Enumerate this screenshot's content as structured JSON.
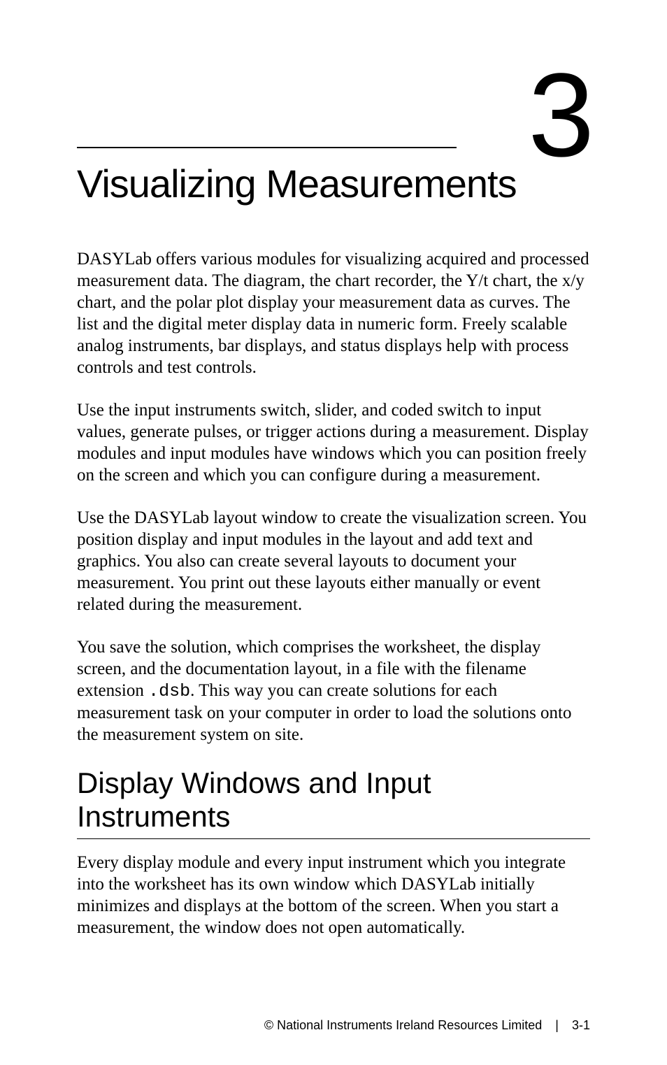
{
  "chapter": {
    "number": "3",
    "title": "Visualizing Measurements"
  },
  "paragraphs": {
    "p1": "DASYLab offers various modules for visualizing acquired and processed measurement data. The diagram, the chart recorder, the Y/t chart, the x/y chart, and the polar plot display your measurement data as curves.  The list and the digital meter display data in numeric form. Freely scalable analog instruments, bar displays, and status displays help with process controls and test controls.",
    "p2": "Use the input instruments switch, slider, and coded switch to input values, generate pulses, or trigger actions during a measurement. Display modules and input modules have windows which you can position freely on the screen and which you can configure during a measurement.",
    "p3": "Use the DASYLab layout window to create the visualization screen. You position display and input modules in the layout and add text and graphics. You also can create several layouts to document your measurement. You print out these layouts either manually or event related during the measurement.",
    "p4_a": "You save the solution, which comprises the worksheet, the display screen, and the documentation layout, in a file with the filename extension ",
    "p4_code": ".dsb",
    "p4_b": ". This way you can create solutions for each measurement task on your computer in order to load the solutions onto the measurement system on site.",
    "p5": "Every display module and every input instrument which you integrate into the worksheet has its own window which DASYLab initially minimizes and displays at the bottom of the screen. When you start a measurement, the window does not open automatically."
  },
  "section": {
    "heading": "Display Windows and Input Instruments"
  },
  "footer": {
    "copyright": "© National Instruments Ireland Resources Limited",
    "separator": "|",
    "page": "3-1"
  }
}
